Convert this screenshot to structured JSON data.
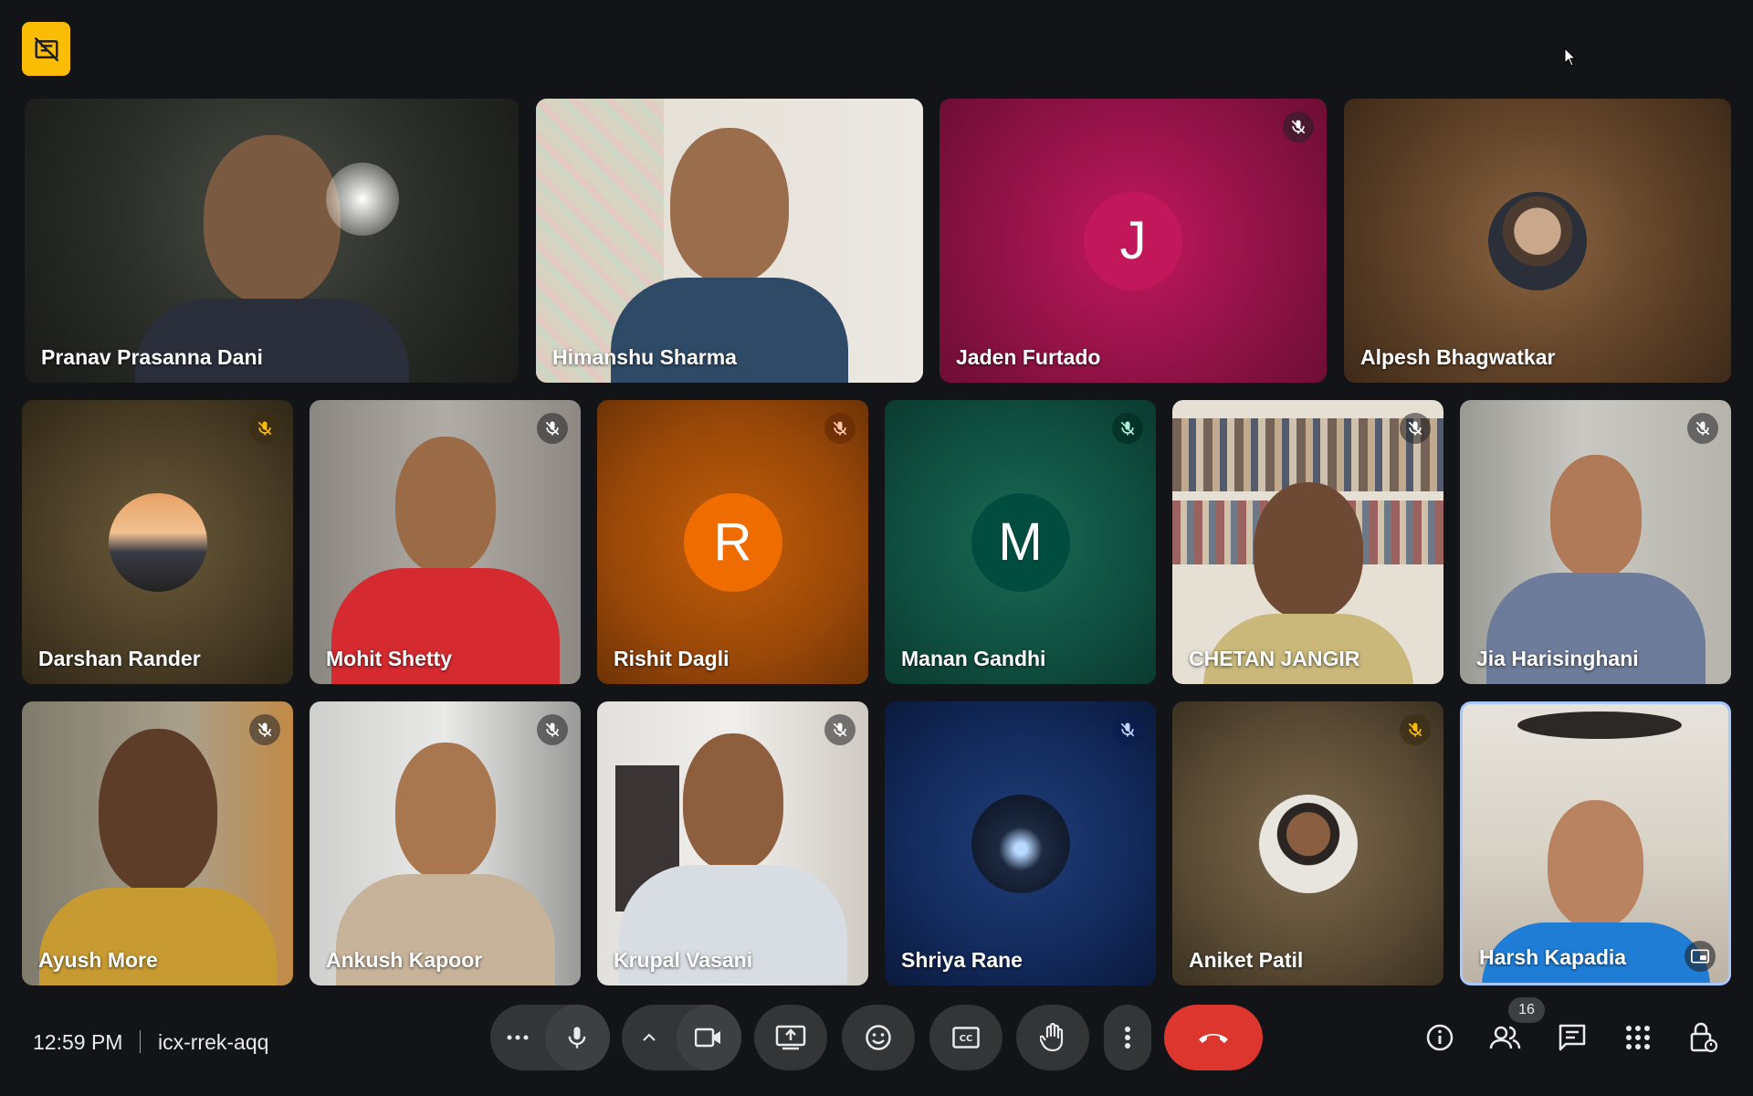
{
  "meeting": {
    "time": "12:59 PM",
    "code": "icx-rrek-aqq",
    "participant_count": "16"
  },
  "participants": [
    {
      "name": "Pranav Prasanna Dani",
      "muted": false
    },
    {
      "name": "Himanshu Sharma",
      "muted": false
    },
    {
      "name": "Jaden Furtado",
      "muted": true,
      "initial": "J",
      "avatar_color": "#c2185b"
    },
    {
      "name": "Alpesh Bhagwatkar",
      "muted": false
    },
    {
      "name": "Darshan Rander",
      "muted": true
    },
    {
      "name": "Mohit Shetty",
      "muted": true
    },
    {
      "name": "Rishit Dagli",
      "muted": true,
      "initial": "R",
      "avatar_color": "#ef6c00"
    },
    {
      "name": "Manan Gandhi",
      "muted": true,
      "initial": "M",
      "avatar_color": "#004d40"
    },
    {
      "name": "CHETAN JANGIR",
      "muted": true
    },
    {
      "name": "Jia Harisinghani",
      "muted": true
    },
    {
      "name": "Ayush More",
      "muted": true
    },
    {
      "name": "Ankush Kapoor",
      "muted": true
    },
    {
      "name": "Krupal Vasani",
      "muted": true
    },
    {
      "name": "Shriya Rane",
      "muted": true
    },
    {
      "name": "Aniket Patil",
      "muted": true
    },
    {
      "name": "Harsh Kapadia",
      "muted": false,
      "active": true
    }
  ],
  "colors": {
    "background": "#131417",
    "end_call": "#dc362e",
    "badge": "#fbbc04",
    "active_border": "#a8c7fa"
  },
  "icons": {
    "top_left": "video-off-icon",
    "controls": [
      "more-horiz-icon",
      "mic-icon",
      "chevron-up-icon",
      "camera-icon",
      "present-icon",
      "emoji-icon",
      "captions-icon",
      "raise-hand-icon",
      "more-vert-icon",
      "end-call-icon"
    ],
    "right": [
      "info-icon",
      "people-icon",
      "chat-icon",
      "activities-icon",
      "host-controls-icon"
    ]
  }
}
